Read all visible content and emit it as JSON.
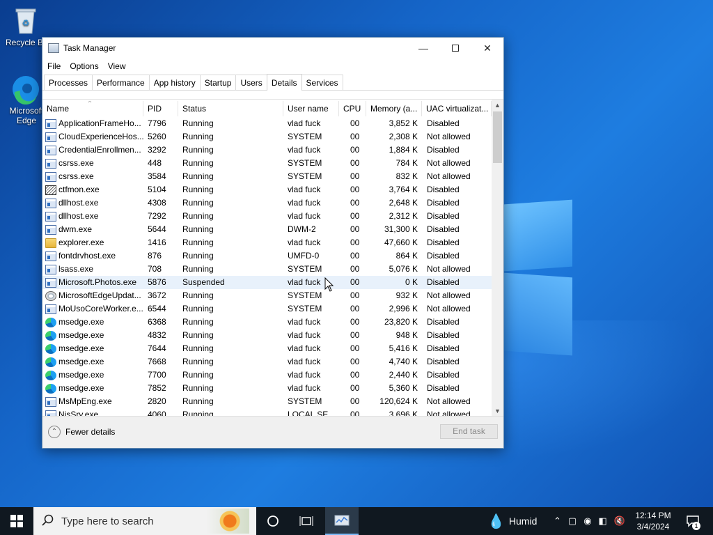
{
  "desktop": {
    "icons": [
      {
        "label": "Recycle Bin",
        "icon": "recycle-bin-icon"
      },
      {
        "label": "Microsoft Edge",
        "icon": "edge-icon"
      }
    ]
  },
  "window": {
    "title": "Task Manager",
    "menu": [
      "File",
      "Options",
      "View"
    ],
    "tabs": [
      "Processes",
      "Performance",
      "App history",
      "Startup",
      "Users",
      "Details",
      "Services"
    ],
    "active_tab": "Details",
    "columns": [
      "Name",
      "PID",
      "Status",
      "User name",
      "CPU",
      "Memory (a...",
      "UAC virtualizat..."
    ],
    "rows": [
      {
        "icon": "generic",
        "name": "ApplicationFrameHo...",
        "pid": "7796",
        "status": "Running",
        "user": "vlad fuck",
        "cpu": "00",
        "mem": "3,852 K",
        "uac": "Disabled"
      },
      {
        "icon": "generic",
        "name": "CloudExperienceHos...",
        "pid": "5260",
        "status": "Running",
        "user": "SYSTEM",
        "cpu": "00",
        "mem": "2,308 K",
        "uac": "Not allowed"
      },
      {
        "icon": "generic",
        "name": "CredentialEnrollmen...",
        "pid": "3292",
        "status": "Running",
        "user": "vlad fuck",
        "cpu": "00",
        "mem": "1,884 K",
        "uac": "Disabled"
      },
      {
        "icon": "generic",
        "name": "csrss.exe",
        "pid": "448",
        "status": "Running",
        "user": "SYSTEM",
        "cpu": "00",
        "mem": "784 K",
        "uac": "Not allowed"
      },
      {
        "icon": "generic",
        "name": "csrss.exe",
        "pid": "3584",
        "status": "Running",
        "user": "SYSTEM",
        "cpu": "00",
        "mem": "832 K",
        "uac": "Not allowed"
      },
      {
        "icon": "ctf",
        "name": "ctfmon.exe",
        "pid": "5104",
        "status": "Running",
        "user": "vlad fuck",
        "cpu": "00",
        "mem": "3,764 K",
        "uac": "Disabled"
      },
      {
        "icon": "generic",
        "name": "dllhost.exe",
        "pid": "4308",
        "status": "Running",
        "user": "vlad fuck",
        "cpu": "00",
        "mem": "2,648 K",
        "uac": "Disabled"
      },
      {
        "icon": "generic",
        "name": "dllhost.exe",
        "pid": "7292",
        "status": "Running",
        "user": "vlad fuck",
        "cpu": "00",
        "mem": "2,312 K",
        "uac": "Disabled"
      },
      {
        "icon": "generic",
        "name": "dwm.exe",
        "pid": "5644",
        "status": "Running",
        "user": "DWM-2",
        "cpu": "00",
        "mem": "31,300 K",
        "uac": "Disabled"
      },
      {
        "icon": "folder",
        "name": "explorer.exe",
        "pid": "1416",
        "status": "Running",
        "user": "vlad fuck",
        "cpu": "00",
        "mem": "47,660 K",
        "uac": "Disabled"
      },
      {
        "icon": "generic",
        "name": "fontdrvhost.exe",
        "pid": "876",
        "status": "Running",
        "user": "UMFD-0",
        "cpu": "00",
        "mem": "864 K",
        "uac": "Disabled"
      },
      {
        "icon": "generic",
        "name": "lsass.exe",
        "pid": "708",
        "status": "Running",
        "user": "SYSTEM",
        "cpu": "00",
        "mem": "5,076 K",
        "uac": "Not allowed"
      },
      {
        "icon": "generic",
        "name": "Microsoft.Photos.exe",
        "pid": "5876",
        "status": "Suspended",
        "user": "vlad fuck",
        "cpu": "00",
        "mem": "0 K",
        "uac": "Disabled",
        "highlight": true
      },
      {
        "icon": "upd",
        "name": "MicrosoftEdgeUpdat...",
        "pid": "3672",
        "status": "Running",
        "user": "SYSTEM",
        "cpu": "00",
        "mem": "932 K",
        "uac": "Not allowed"
      },
      {
        "icon": "generic",
        "name": "MoUsoCoreWorker.e...",
        "pid": "6544",
        "status": "Running",
        "user": "SYSTEM",
        "cpu": "00",
        "mem": "2,996 K",
        "uac": "Not allowed"
      },
      {
        "icon": "edge",
        "name": "msedge.exe",
        "pid": "6368",
        "status": "Running",
        "user": "vlad fuck",
        "cpu": "00",
        "mem": "23,820 K",
        "uac": "Disabled"
      },
      {
        "icon": "edge",
        "name": "msedge.exe",
        "pid": "4832",
        "status": "Running",
        "user": "vlad fuck",
        "cpu": "00",
        "mem": "948 K",
        "uac": "Disabled"
      },
      {
        "icon": "edge",
        "name": "msedge.exe",
        "pid": "7644",
        "status": "Running",
        "user": "vlad fuck",
        "cpu": "00",
        "mem": "5,416 K",
        "uac": "Disabled"
      },
      {
        "icon": "edge",
        "name": "msedge.exe",
        "pid": "7668",
        "status": "Running",
        "user": "vlad fuck",
        "cpu": "00",
        "mem": "4,740 K",
        "uac": "Disabled"
      },
      {
        "icon": "edge",
        "name": "msedge.exe",
        "pid": "7700",
        "status": "Running",
        "user": "vlad fuck",
        "cpu": "00",
        "mem": "2,440 K",
        "uac": "Disabled"
      },
      {
        "icon": "edge",
        "name": "msedge.exe",
        "pid": "7852",
        "status": "Running",
        "user": "vlad fuck",
        "cpu": "00",
        "mem": "5,360 K",
        "uac": "Disabled"
      },
      {
        "icon": "generic",
        "name": "MsMpEng.exe",
        "pid": "2820",
        "status": "Running",
        "user": "SYSTEM",
        "cpu": "00",
        "mem": "120,624 K",
        "uac": "Not allowed"
      },
      {
        "icon": "generic",
        "name": "NisSrv.exe",
        "pid": "4060",
        "status": "Running",
        "user": "LOCAL SE...",
        "cpu": "00",
        "mem": "3,696 K",
        "uac": "Not allowed"
      }
    ],
    "footer": {
      "fewer_details": "Fewer details",
      "end_task": "End task"
    }
  },
  "taskbar": {
    "search_placeholder": "Type here to search",
    "weather": "Humid",
    "time": "12:14 PM",
    "date": "3/4/2024",
    "notification_count": "1"
  }
}
